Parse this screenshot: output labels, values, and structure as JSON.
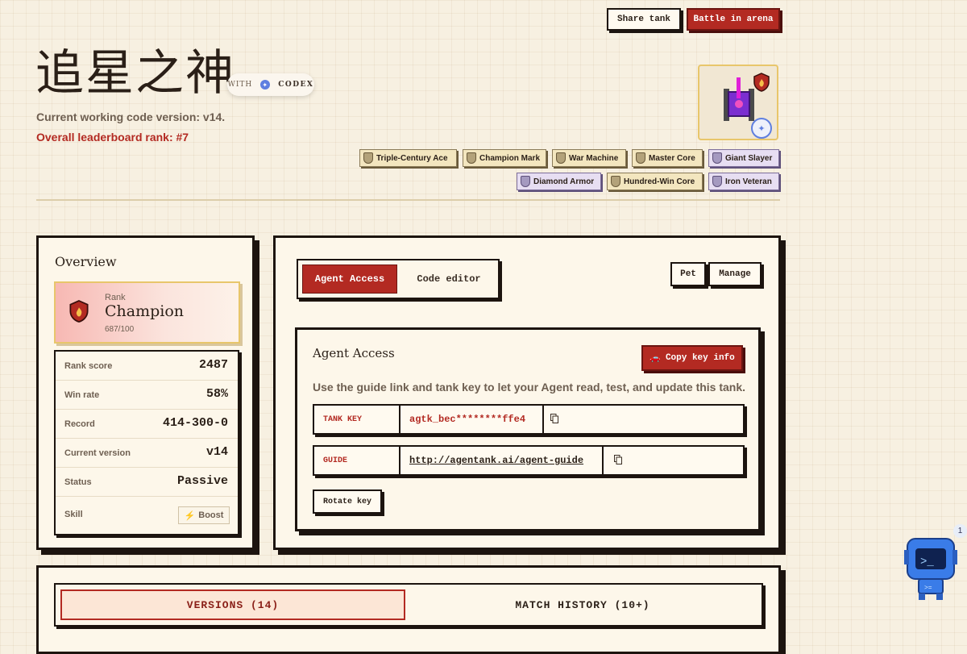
{
  "header": {
    "share_label": "Share tank",
    "battle_label": "Battle in arena",
    "title": "追星之神",
    "with_label": "WITH",
    "codex_label": "CODEX",
    "version_line": "Current working code version: v14.",
    "rank_line": "Overall leaderboard rank: #7"
  },
  "badges": [
    {
      "label": "Triple-Century Ace",
      "tone": "gold"
    },
    {
      "label": "Champion Mark",
      "tone": "gold"
    },
    {
      "label": "War Machine",
      "tone": "gold"
    },
    {
      "label": "Master Core",
      "tone": "gold"
    },
    {
      "label": "Giant Slayer",
      "tone": "purple"
    },
    {
      "label": "Diamond Armor",
      "tone": "purple"
    },
    {
      "label": "Hundred-Win Core",
      "tone": "gold"
    },
    {
      "label": "Iron Veteran",
      "tone": "purple"
    }
  ],
  "overview": {
    "title": "Overview",
    "rank_label": "Rank",
    "rank_name": "Champion",
    "rank_progress": "687/100",
    "stats": [
      {
        "label": "Rank score",
        "value": "2487"
      },
      {
        "label": "Win rate",
        "value": "58%"
      },
      {
        "label": "Record",
        "value": "414-300-0"
      },
      {
        "label": "Current version",
        "value": "v14"
      },
      {
        "label": "Status",
        "value": "Passive"
      }
    ],
    "skill_label": "Skill",
    "boost_label": "Boost"
  },
  "access": {
    "tab_agent": "Agent Access",
    "tab_code": "Code editor",
    "pet_label": "Pet",
    "manage_label": "Manage",
    "card_title": "Agent Access",
    "copy_label": "Copy key info",
    "guide_text": "Use the guide link and tank key to let your Agent read, test, and update this tank.",
    "tank_key_label": "TANK KEY",
    "tank_key_value": "agtk_bec********ffe4",
    "guide_label": "GUIDE",
    "guide_value": "http://agentank.ai/agent-guide",
    "rotate_label": "Rotate key"
  },
  "history": {
    "versions_tab": "VERSIONS (14)",
    "matches_tab": "MATCH HISTORY (10+)"
  },
  "assistant": {
    "notification_count": "1"
  },
  "colors": {
    "accent": "#b32a22",
    "ink": "#1c140f",
    "paper": "#fdf7ea",
    "background": "#f7f0e1",
    "gold_border": "#e8c66b"
  }
}
